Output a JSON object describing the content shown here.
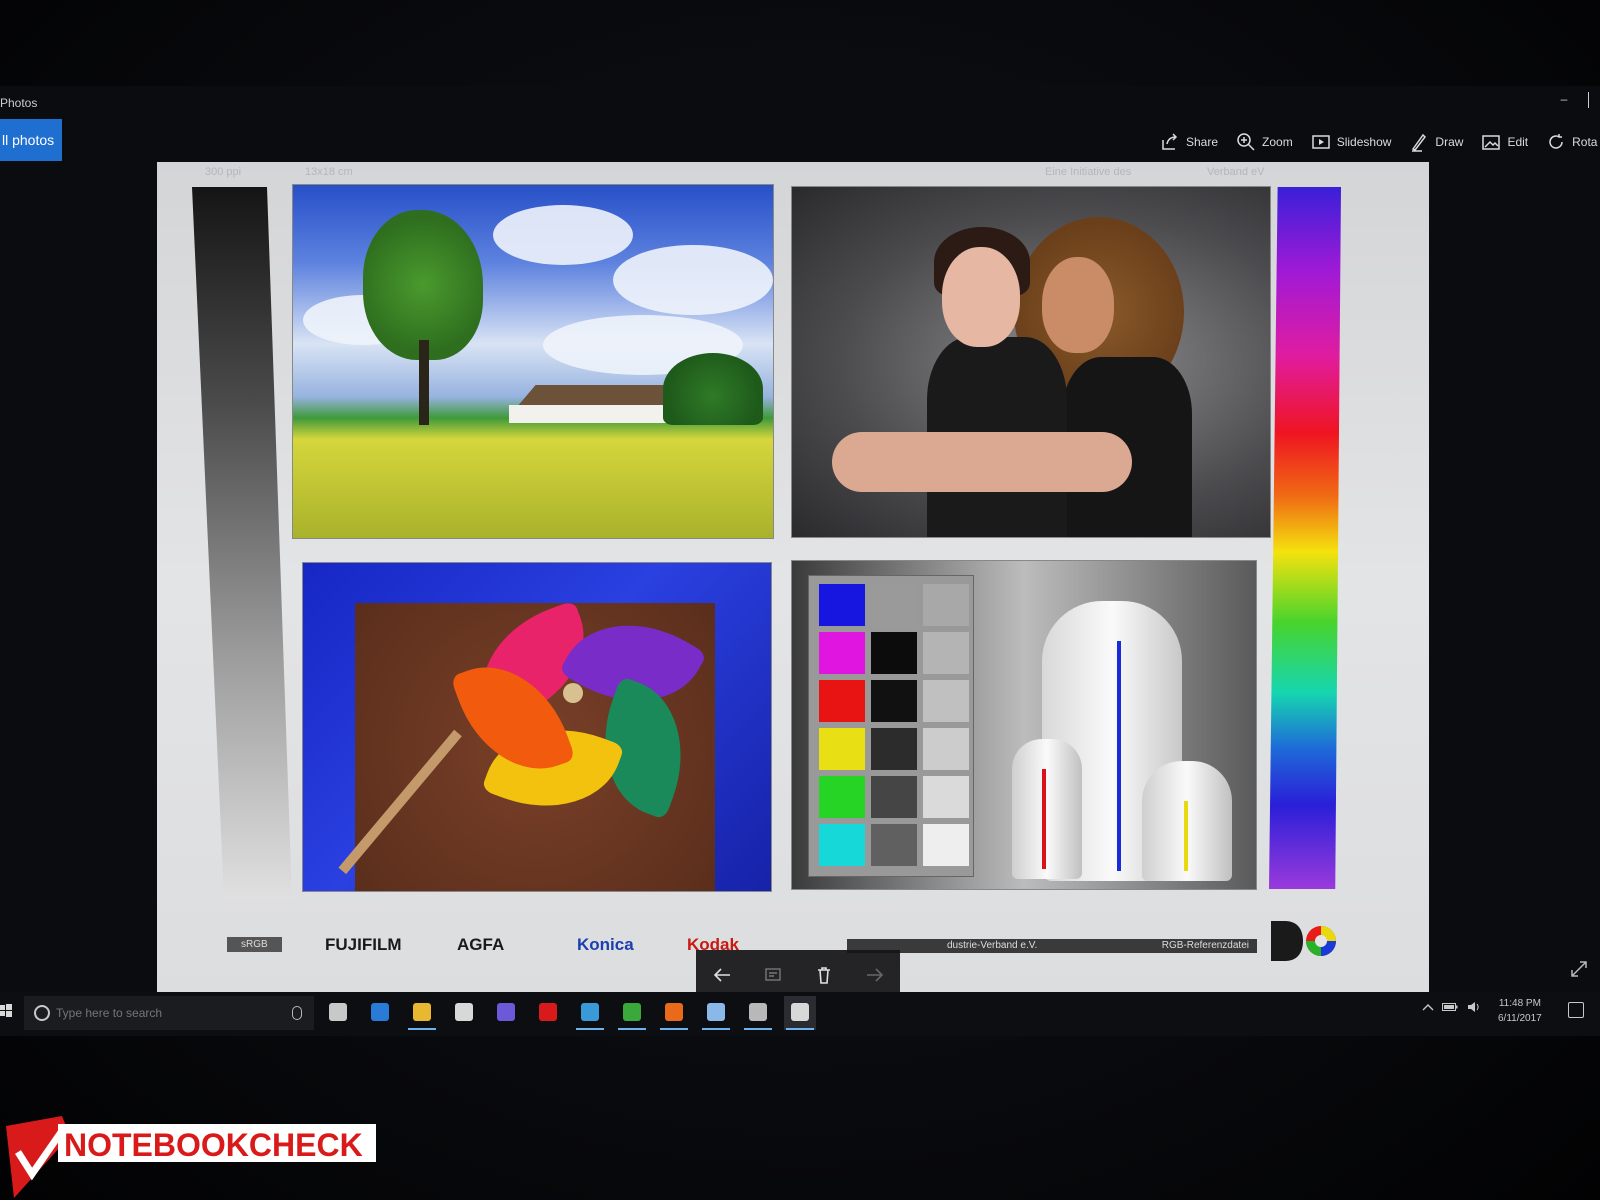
{
  "window": {
    "app_title": "Photos",
    "minimize": "–"
  },
  "nav": {
    "all_photos": "ll photos"
  },
  "toolbar": {
    "items": [
      {
        "label": "Share",
        "icon": "share-icon"
      },
      {
        "label": "Zoom",
        "icon": "zoom-icon"
      },
      {
        "label": "Slideshow",
        "icon": "slideshow-icon"
      },
      {
        "label": "Draw",
        "icon": "draw-icon"
      },
      {
        "label": "Edit",
        "icon": "edit-icon"
      },
      {
        "label": "Rota",
        "icon": "rotate-icon"
      }
    ]
  },
  "photo": {
    "top_labels": {
      "ppi": "300 ppi",
      "size": "13x18 cm",
      "initiative": "Eine Initiative des",
      "verband": "Verband eV"
    },
    "swatches": [
      "#1616e0",
      "#9a9a9a",
      "#a8a8a8",
      "#e016e0",
      "#0c0c0c",
      "#b4b4b4",
      "#e81414",
      "#111111",
      "#c0c0c0",
      "#e8e014",
      "#2c2c2c",
      "#cccccc",
      "#26d426",
      "#454545",
      "#dadada",
      "#16d8d8",
      "#606060",
      "#eeeeee"
    ],
    "logos": {
      "srgb": "sRGB",
      "fujifilm": "FUJIFILM",
      "agfa": "AGFA",
      "konica": "Konica",
      "kodak": "Kodak",
      "ref_left": "dustrie-Verband e.V.",
      "ref_right": "RGB-Referenzdatei"
    }
  },
  "taskbar": {
    "search_placeholder": "Type here to search",
    "apps": [
      {
        "name": "task-view",
        "color": "#c8c8c8"
      },
      {
        "name": "edge",
        "color": "#2a7ad8"
      },
      {
        "name": "file-explorer",
        "color": "#e8b830"
      },
      {
        "name": "store",
        "color": "#d8d8d8"
      },
      {
        "name": "browser",
        "color": "#6a5ad8"
      },
      {
        "name": "mcafee",
        "color": "#d81a1a"
      },
      {
        "name": "app-blue",
        "color": "#3a9ad8"
      },
      {
        "name": "app-green",
        "color": "#3aa83a"
      },
      {
        "name": "app-orange",
        "color": "#e86a1a"
      },
      {
        "name": "app-light",
        "color": "#8ab8e8"
      },
      {
        "name": "app-gray",
        "color": "#b8b8b8"
      },
      {
        "name": "photos",
        "color": "#d8d8d8"
      }
    ],
    "time": "11:48 PM",
    "date": "6/11/2017"
  },
  "watermark": "NOTEBOOKCHECK",
  "colors": {
    "accent": "#1f6fd0",
    "taskbar_bg": "#0d0e11"
  }
}
